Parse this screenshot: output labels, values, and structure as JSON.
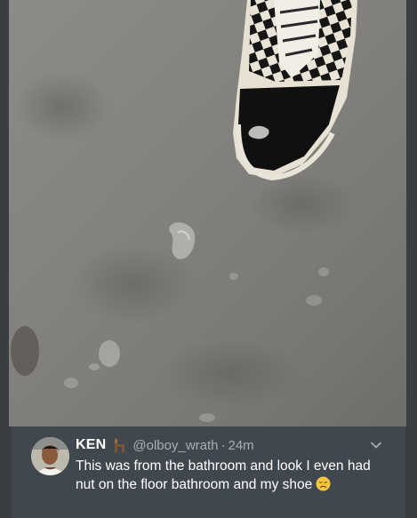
{
  "tweet": {
    "display_name": "KEN",
    "name_badge_icon": "chair-icon",
    "username": "@olboy_wrath",
    "separator": "·",
    "timestamp": "24m",
    "text": "This was from the bathroom and look I even had nut on the floor bathroom and my shoe",
    "emoji_icon": "disappointed-face-icon",
    "menu_icon": "chevron-down-icon"
  },
  "colors": {
    "background": "#3a3d41",
    "card": "#41474e",
    "name": "#ffffff",
    "secondary_text": "#a6afb7",
    "floor": "#84827e"
  }
}
